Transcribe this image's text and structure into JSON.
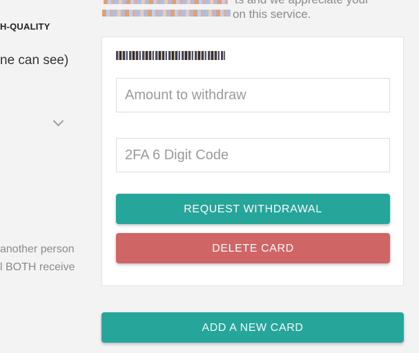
{
  "left": {
    "heading": "H-QUALITY",
    "visibility": "ne can see)",
    "referral_line_1": " another person",
    "referral_line_2": "l BOTH receive"
  },
  "intro": {
    "line_1": "ts and we appreciate your",
    "line_2": "on this service."
  },
  "card": {
    "amount_placeholder": "Amount to withdraw",
    "twofa_placeholder": "2FA 6 Digit Code",
    "request_label": "REQUEST WITHDRAWAL",
    "delete_label": "DELETE CARD"
  },
  "add_card_label": "ADD A NEW CARD",
  "colors": {
    "primary": "#26a69a",
    "danger": "#cf6565",
    "background": "#f3f3f3"
  }
}
